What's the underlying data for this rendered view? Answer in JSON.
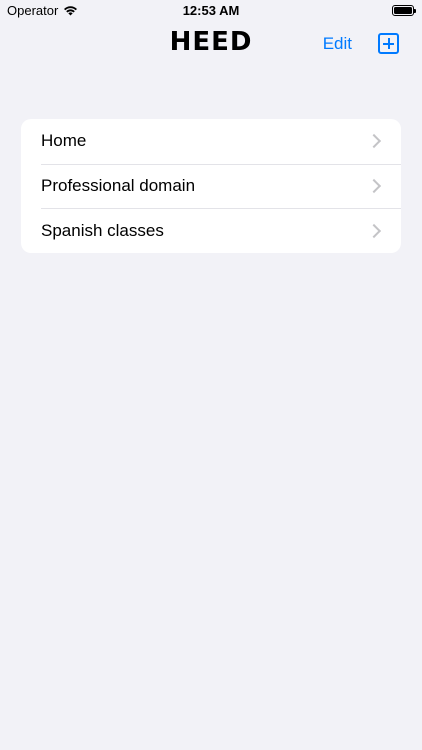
{
  "status_bar": {
    "carrier": "Operator",
    "time": "12:53 AM",
    "battery_level": 1.0
  },
  "nav": {
    "title": "HEED",
    "edit_label": "Edit",
    "add_icon": "plus-square-icon"
  },
  "list": {
    "items": [
      {
        "label": "Home"
      },
      {
        "label": "Professional domain"
      },
      {
        "label": "Spanish classes"
      }
    ]
  },
  "colors": {
    "accent": "#007aff",
    "background": "#f2f2f7",
    "card": "#ffffff",
    "chevron": "#c4c4c7"
  }
}
